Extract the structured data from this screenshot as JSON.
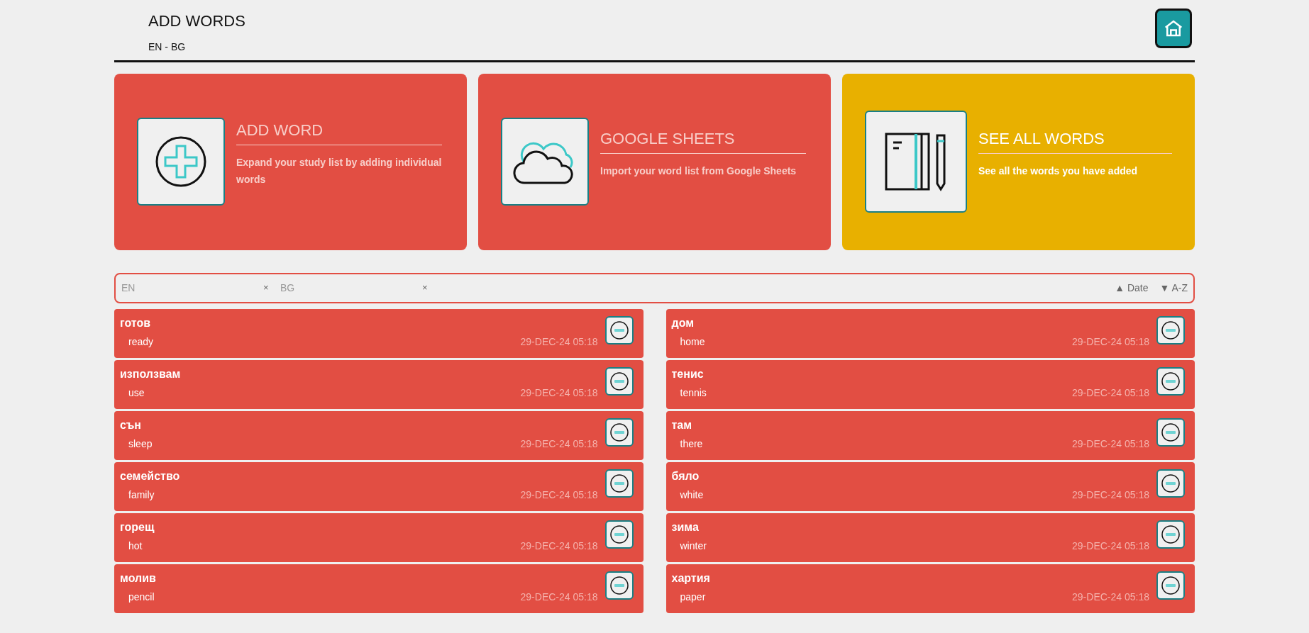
{
  "header": {
    "title": "ADD WORDS",
    "subtitle": "EN - BG"
  },
  "cards": [
    {
      "kind": "add",
      "title": "ADD WORD",
      "description": "Expand your study list by adding individual words",
      "selected": false
    },
    {
      "kind": "cloud",
      "title": "GOOGLE SHEETS",
      "description": "Import your word list from Google Sheets",
      "selected": false
    },
    {
      "kind": "notebook",
      "title": "SEE ALL WORDS",
      "description": "See all the words you have added",
      "selected": true
    }
  ],
  "filters": [
    {
      "placeholder": "EN",
      "clear": "×"
    },
    {
      "placeholder": "BG",
      "clear": "×"
    }
  ],
  "sort": [
    {
      "arrow": "▲",
      "label": "Date"
    },
    {
      "arrow": "▼",
      "label": "A-Z"
    }
  ],
  "words": [
    [
      {
        "word": "готов",
        "translation": "ready",
        "date": "29-DEC-24 05:18"
      },
      {
        "word": "използвам",
        "translation": "use",
        "date": "29-DEC-24 05:18"
      },
      {
        "word": "сън",
        "translation": "sleep",
        "date": "29-DEC-24 05:18"
      },
      {
        "word": "семейство",
        "translation": "family",
        "date": "29-DEC-24 05:18"
      },
      {
        "word": "горещ",
        "translation": "hot",
        "date": "29-DEC-24 05:18"
      },
      {
        "word": "молив",
        "translation": "pencil",
        "date": "29-DEC-24 05:18"
      }
    ],
    [
      {
        "word": "дом",
        "translation": "home",
        "date": "29-DEC-24 05:18"
      },
      {
        "word": "тенис",
        "translation": "tennis",
        "date": "29-DEC-24 05:18"
      },
      {
        "word": "там",
        "translation": "there",
        "date": "29-DEC-24 05:18"
      },
      {
        "word": "бяло",
        "translation": "white",
        "date": "29-DEC-24 05:18"
      },
      {
        "word": "зима",
        "translation": "winter",
        "date": "29-DEC-24 05:18"
      },
      {
        "word": "хартия",
        "translation": "paper",
        "date": "29-DEC-24 05:18"
      }
    ]
  ]
}
